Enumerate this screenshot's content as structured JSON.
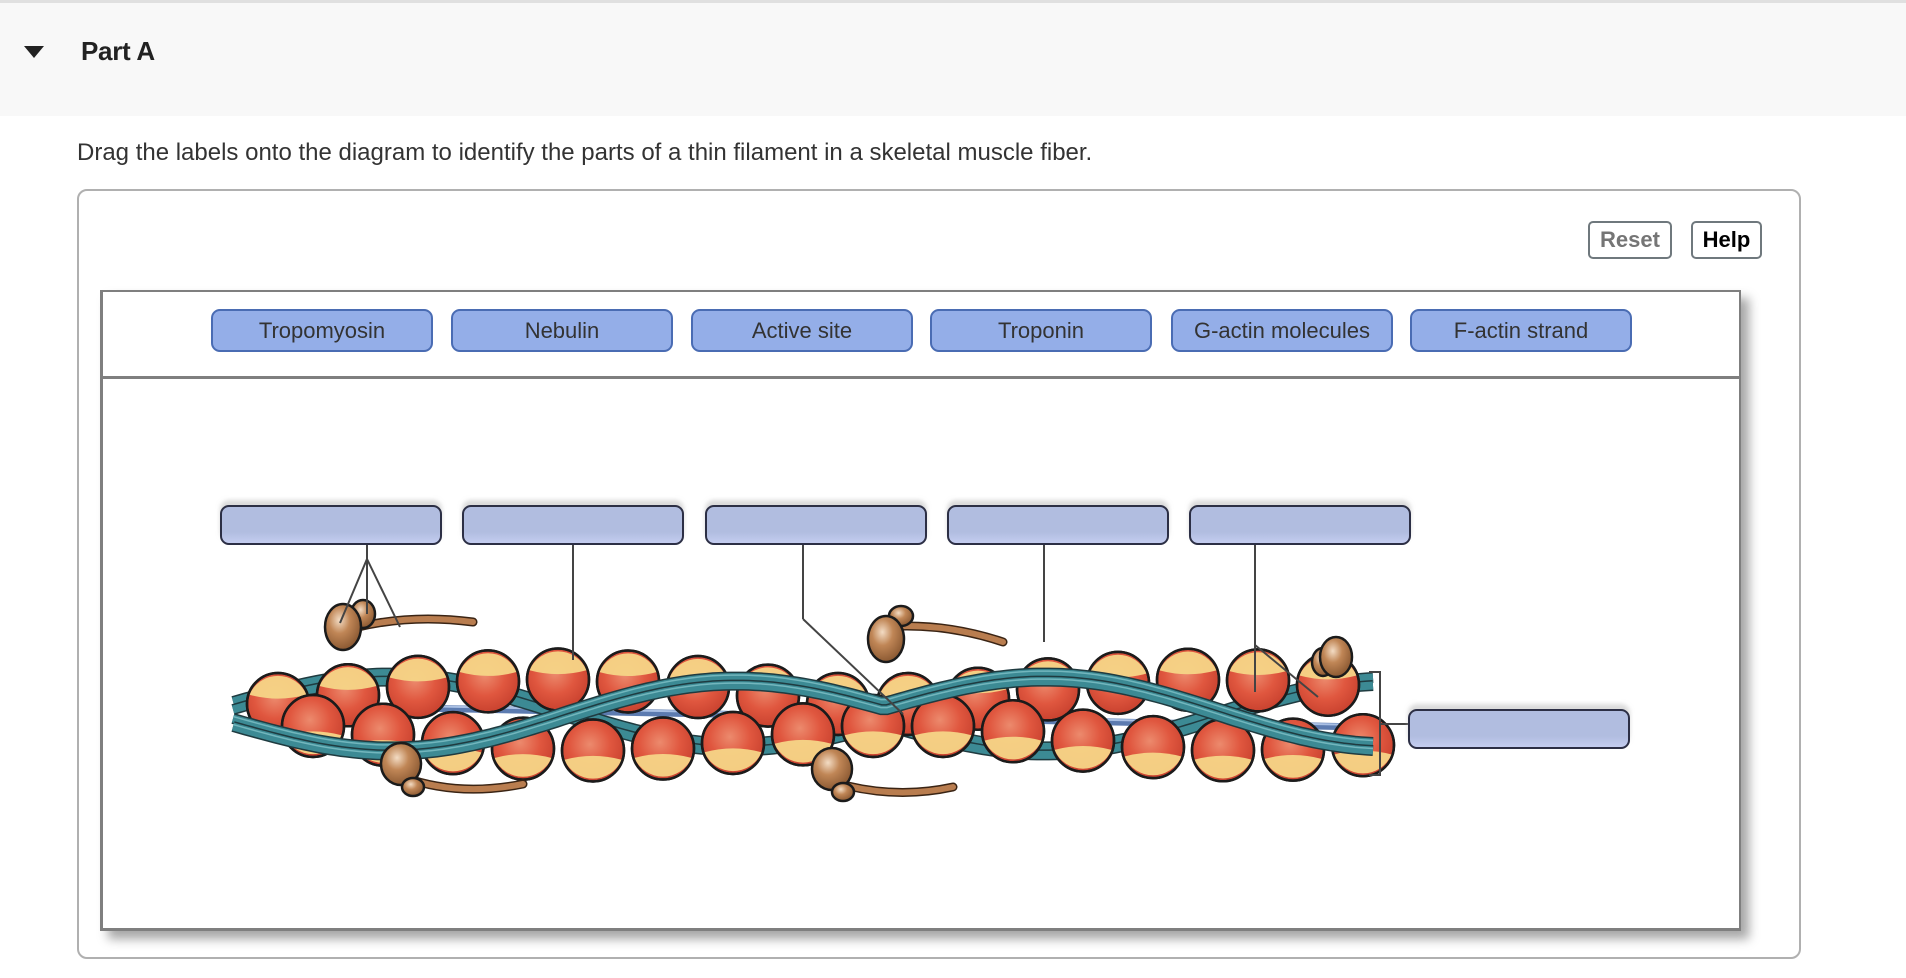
{
  "header": {
    "toggle_icon": "caret-down-icon",
    "title": "Part A"
  },
  "instructions": "Drag the labels onto the diagram to identify the parts of a thin filament in a skeletal muscle fiber.",
  "toolbar": {
    "reset_label": "Reset",
    "help_label": "Help"
  },
  "label_bank": [
    {
      "label": "Tropomyosin"
    },
    {
      "label": "Nebulin"
    },
    {
      "label": "Active site"
    },
    {
      "label": "Troponin"
    },
    {
      "label": "G-actin molecules"
    },
    {
      "label": "F-actin strand"
    }
  ],
  "drop_targets": [
    {
      "target": "troponin-pointer",
      "value": ""
    },
    {
      "target": "g-actin-pointer",
      "value": ""
    },
    {
      "target": "nebulin-pointer",
      "value": ""
    },
    {
      "target": "tropomyosin-pointer",
      "value": ""
    },
    {
      "target": "active-site-pointer",
      "value": ""
    },
    {
      "target": "f-actin-bracket",
      "value": ""
    }
  ],
  "colors": {
    "chip_fill": "#94aee8",
    "chip_border": "#4a6cb3",
    "dropzone_fill": "#b1bde0",
    "actin_red": "#e0573f",
    "actin_highlight": "#f6d587",
    "tropomyosin_teal": "#3c8a94",
    "troponin_brown": "#b97d4f",
    "nebulin_blue": "#5c7bb0"
  }
}
